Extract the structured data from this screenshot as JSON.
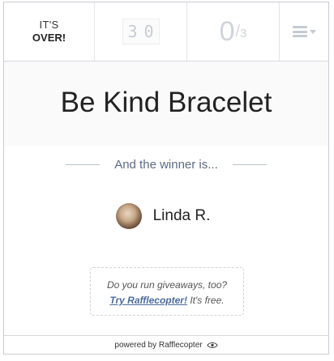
{
  "stats": {
    "status_line1": "IT'S",
    "status_line2": "OVER!",
    "timer_digits": [
      "3",
      "0"
    ],
    "entries_count": "0",
    "entries_separator": "/",
    "entries_total": "3",
    "menu_icon": "hamburger-menu-icon"
  },
  "giveaway": {
    "title": "Be Kind Bracelet"
  },
  "winner": {
    "heading": "And the winner is...",
    "name": "Linda R."
  },
  "promo": {
    "question": "Do you run giveaways, too?",
    "link": "Try Rafflecopter!",
    "suffix": "It's free."
  },
  "footer": {
    "text": "powered by Rafflecopter",
    "icon": "rafflecopter-eye-icon"
  },
  "colors": {
    "border": "#c9ccd3",
    "muted": "#cfd3da",
    "accent_text": "#5a6b84",
    "link": "#4a6c9b"
  }
}
